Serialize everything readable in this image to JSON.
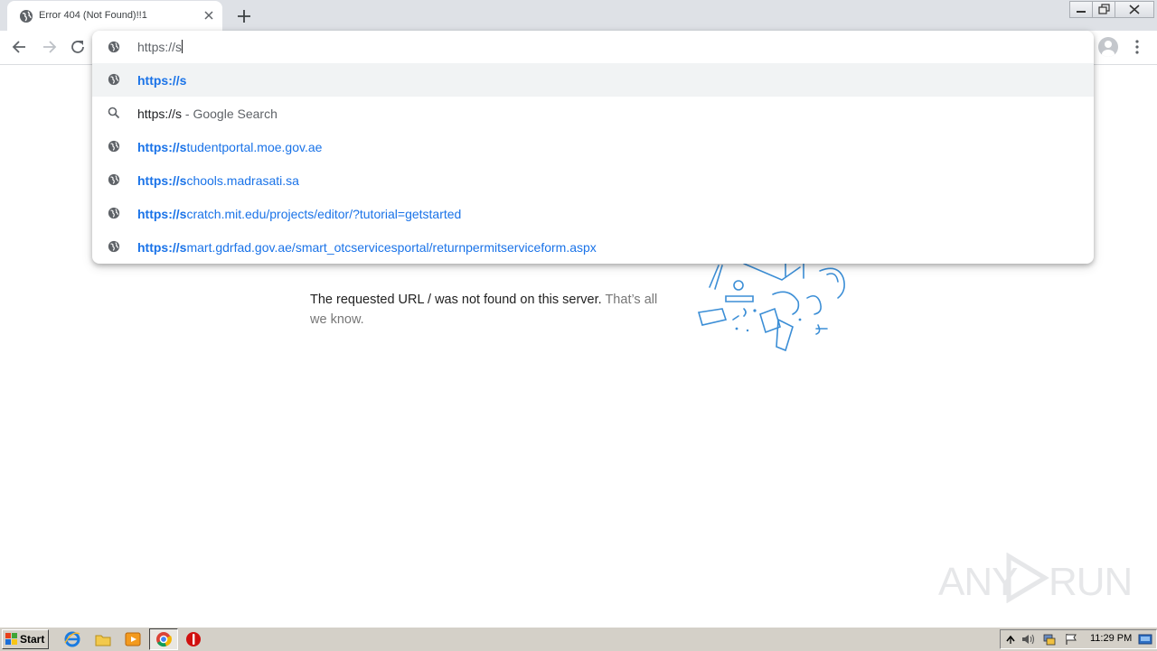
{
  "tab": {
    "title": "Error 404 (Not Found)!!1"
  },
  "omnibox": {
    "typed": "https://s",
    "suggestions": [
      {
        "kind": "url",
        "match": "https://s",
        "rest": "",
        "icon": "globe-icon"
      },
      {
        "kind": "search",
        "query": "https://s",
        "suffix": " - Google Search",
        "icon": "search-icon"
      },
      {
        "kind": "url",
        "match": "https://s",
        "rest": "tudentportal.moe.gov.ae",
        "icon": "globe-icon"
      },
      {
        "kind": "url",
        "match": "https://s",
        "rest": "chools.madrasati.sa",
        "icon": "globe-icon"
      },
      {
        "kind": "url",
        "match": "https://s",
        "rest": "cratch.mit.edu/projects/editor/?tutorial=getstarted",
        "icon": "globe-icon"
      },
      {
        "kind": "url",
        "match": "https://s",
        "rest": "mart.gdrfad.gov.ae/smart_otcservicesportal/returnpermitserviceform.aspx",
        "icon": "globe-icon"
      }
    ]
  },
  "page": {
    "message": "The requested URL / was not found on this server.",
    "muted": "That’s all we know."
  },
  "watermark": {
    "left": "ANY",
    "right": "RUN"
  },
  "taskbar": {
    "start_label": "Start",
    "clock": "11:29 PM"
  },
  "colors": {
    "link": "#1a73e8",
    "tabstrip": "#dee1e6",
    "taskbar": "#d4d0c8"
  }
}
